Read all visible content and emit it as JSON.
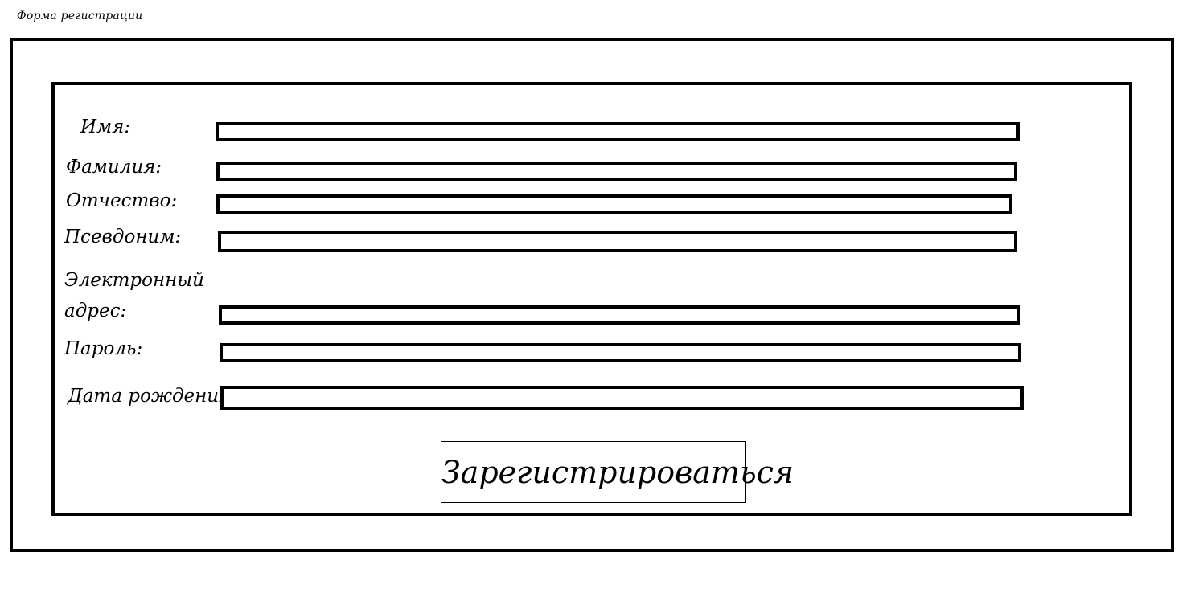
{
  "page": {
    "title": "Форма регистрации"
  },
  "form": {
    "fields": [
      {
        "label": "Имя:",
        "value": "",
        "placeholder": ""
      },
      {
        "label": "Фамилия:",
        "value": "",
        "placeholder": ""
      },
      {
        "label": "Отчество:",
        "value": "",
        "placeholder": ""
      },
      {
        "label": "Псевдоним:",
        "value": "",
        "placeholder": ""
      },
      {
        "label_line1": "Электронный",
        "label_line2": "адрес:",
        "value": "",
        "placeholder": ""
      },
      {
        "label": "Пароль:",
        "value": "",
        "placeholder": ""
      },
      {
        "label": "Дата рождения:",
        "value": "",
        "placeholder": ""
      }
    ],
    "submit_label": "Зарегистрироваться"
  }
}
